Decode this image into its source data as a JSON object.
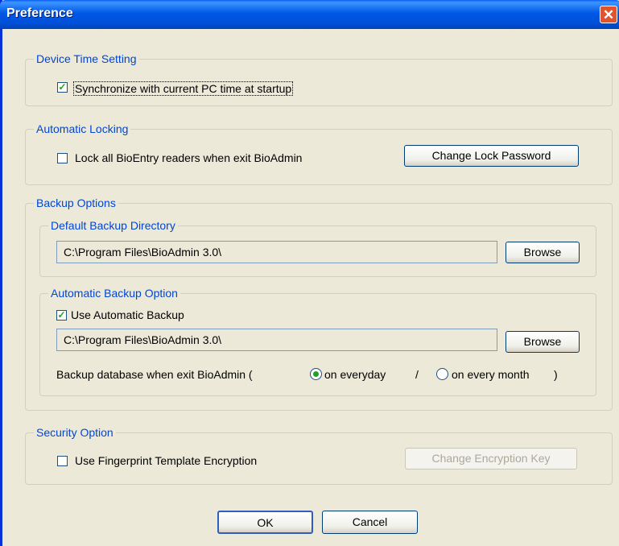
{
  "window": {
    "title": "Preference",
    "close_glyph": "✕"
  },
  "device_time": {
    "legend": "Device Time Setting",
    "sync_label": "Synchronize with current PC time at startup",
    "sync_checked": true
  },
  "auto_lock": {
    "legend": "Automatic Locking",
    "lock_label": "Lock all BioEntry readers when exit BioAdmin",
    "lock_checked": false,
    "change_password_label": "Change Lock Password"
  },
  "backup": {
    "legend": "Backup Options",
    "default_dir": {
      "legend": "Default Backup Directory",
      "path": "C:\\Program Files\\BioAdmin 3.0\\",
      "browse_label": "Browse"
    },
    "auto": {
      "legend": "Automatic Backup Option",
      "use_label": "Use Automatic Backup",
      "use_checked": true,
      "path": "C:\\Program Files\\BioAdmin 3.0\\",
      "browse_label": "Browse",
      "prefix": "Backup database when exit BioAdmin  (",
      "option_everyday": "on everyday",
      "separator": "/",
      "option_month": "on every month",
      "suffix": ")",
      "selected": "on everyday"
    }
  },
  "security": {
    "legend": "Security Option",
    "encrypt_label": "Use Fingerprint Template Encryption",
    "encrypt_checked": false,
    "change_key_label": "Change Encryption Key"
  },
  "footer": {
    "ok_label": "OK",
    "cancel_label": "Cancel"
  },
  "icons": {
    "check_glyph": "✓"
  },
  "colors": {
    "legend_text": "#0046d5",
    "titlebar": "#0058e6",
    "check": "#21a121"
  }
}
